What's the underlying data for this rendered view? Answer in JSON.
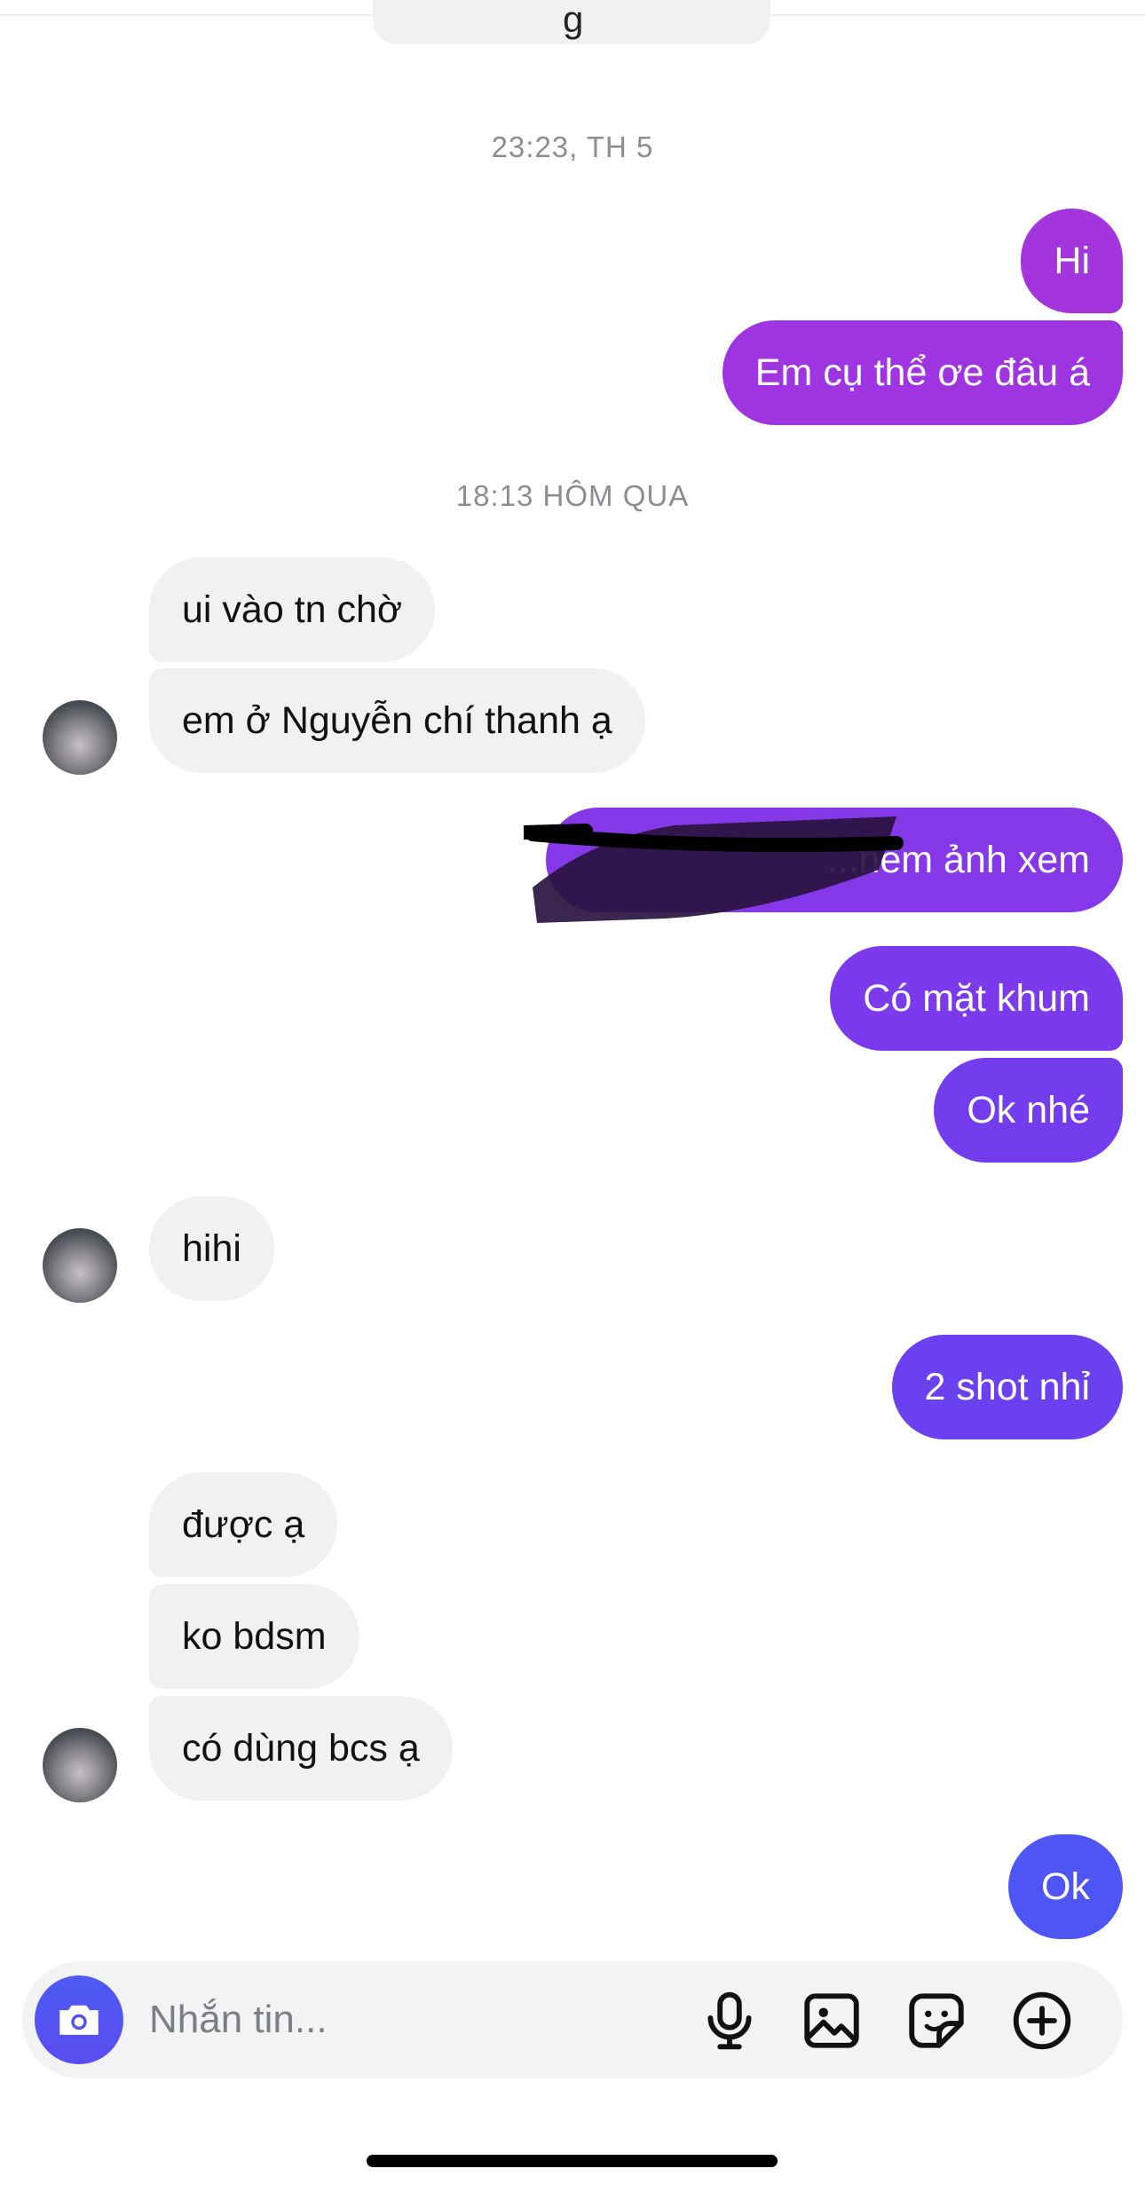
{
  "previous_message_fragment": "g",
  "timestamps": [
    "23:23, TH 5",
    "18:13 HÔM QUA"
  ],
  "messages": [
    {
      "text": "Hi",
      "from": "me"
    },
    {
      "text": "Em cụ thể ơe đâu á",
      "from": "me"
    },
    {
      "text": "ui vào tn chờ",
      "from": "them"
    },
    {
      "text": "em ở Nguyễn chí thanh ạ",
      "from": "them"
    },
    {
      "text": "...hêm ảnh xem",
      "from": "me",
      "redacted": true
    },
    {
      "text": "Có mặt khum",
      "from": "me"
    },
    {
      "text": "Ok nhé",
      "from": "me"
    },
    {
      "text": "hihi",
      "from": "them"
    },
    {
      "text": "2 shot nhỉ",
      "from": "me"
    },
    {
      "text": "được ạ",
      "from": "them"
    },
    {
      "text": "ko bdsm",
      "from": "them"
    },
    {
      "text": "có dùng bcs ạ",
      "from": "them"
    },
    {
      "text": "Ok",
      "from": "me"
    }
  ],
  "composer": {
    "placeholder": "Nhắn tin...",
    "icons": [
      "camera-icon",
      "microphone-icon",
      "image-icon",
      "sticker-icon",
      "plus-icon"
    ]
  },
  "colors": {
    "outgoing_top": "#a233dc",
    "outgoing_bottom": "#4d58f5",
    "incoming": "#f0f1f3",
    "timestamp": "#8a8d91",
    "camera_button": "#5350f2"
  }
}
